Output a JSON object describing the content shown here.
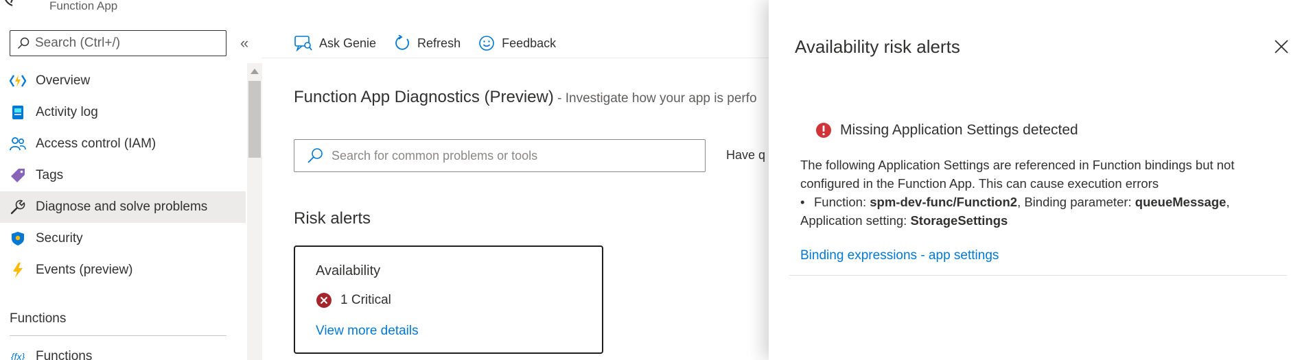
{
  "app": {
    "subtitle": "Function App"
  },
  "sidebar": {
    "search_placeholder": "Search (Ctrl+/)",
    "collapse_glyph": "«",
    "items": [
      {
        "label": "Overview",
        "icon": "function-app-icon"
      },
      {
        "label": "Activity log",
        "icon": "activity-log-icon"
      },
      {
        "label": "Access control (IAM)",
        "icon": "people-icon"
      },
      {
        "label": "Tags",
        "icon": "tag-icon"
      },
      {
        "label": "Diagnose and solve problems",
        "icon": "wrench-icon",
        "selected": true
      },
      {
        "label": "Security",
        "icon": "shield-icon"
      },
      {
        "label": "Events (preview)",
        "icon": "lightning-icon"
      }
    ],
    "section_title": "Functions",
    "section_items": [
      {
        "label": "Functions",
        "icon": "fx-icon",
        "icon_text": "{fx}"
      }
    ]
  },
  "toolbar": {
    "ask_genie": "Ask Genie",
    "refresh": "Refresh",
    "feedback": "Feedback"
  },
  "main": {
    "title": "Function App Diagnostics (Preview)",
    "description": " - Investigate how your app is perfo",
    "search_placeholder": "Search for common problems or tools",
    "have_questions": "Have q",
    "risk_alerts_title": "Risk alerts",
    "card": {
      "title": "Availability",
      "critical_text": "1 Critical",
      "link": "View more details"
    }
  },
  "blade": {
    "title": "Availability risk alerts",
    "alert_title": "Missing Application Settings detected",
    "body_line1": "The following Application Settings are referenced in Function bindings but not configured in the Function App. This can cause execution errors",
    "bullet": "•",
    "function_label": "Function: ",
    "function_value": "spm-dev-func/Function2",
    "binding_label": ", Binding parameter: ",
    "binding_value": "queueMessage",
    "comma": ",",
    "setting_label": "Application setting: ",
    "setting_value": "StorageSettings",
    "link": "Binding expressions - app settings"
  },
  "colors": {
    "accent": "#0078d4",
    "critical": "#a4262c",
    "selected_bg": "#edebe9",
    "error_icon": "#d13438"
  }
}
